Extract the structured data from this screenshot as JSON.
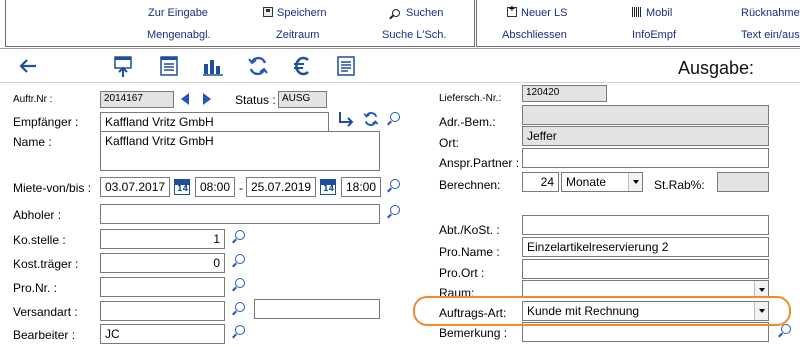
{
  "toolbar": {
    "zur_eingabe": "Zur Eingabe",
    "mengenabgl": "Mengenabgl.",
    "speichern": "Speichern",
    "zeitraum": "Zeitraum",
    "suchen": "Suchen",
    "suche_lsch": "Suche L'Sch.",
    "neuer_ls": "Neuer LS",
    "abschliessen": "Abschliessen",
    "mobil": "Mobil",
    "infoempf": "InfoEmpf",
    "ruecknahme": "Rücknahme",
    "text_ein_aus": "Text ein/aus"
  },
  "iconbar": {
    "icons": [
      "back-arrow-icon",
      "export-doc-icon",
      "list-doc-icon",
      "bar-chart-icon",
      "refresh-icon",
      "euro-icon",
      "text-doc-icon"
    ]
  },
  "heading": "Ausgabe:",
  "left": {
    "auftr_nr_label": "Auftr.Nr :",
    "auftr_nr": "2014167",
    "status_label": "Status :",
    "status": "AUSG",
    "empfaenger_label": "Empfänger :",
    "empfaenger": "Kaffland Vritz GmbH",
    "name_label": "Name :",
    "name": "Kaffland Vritz GmbH",
    "miete_label": "Miete-von/bis :",
    "von_date": "03.07.2017",
    "von_time": "08:00",
    "dash": "-",
    "bis_date": "25.07.2019",
    "bis_time": "18:00",
    "cal_num": "14",
    "abholer_label": "Abholer :",
    "abholer": "",
    "kostelle_label": "Ko.stelle :",
    "kostelle": "1",
    "kosttraeger_label": "Kost.träger :",
    "kosttraeger": "0",
    "pronr_label": "Pro.Nr. :",
    "pronr": "",
    "versandart_label": "Versandart :",
    "versandart": "",
    "versandart2": "",
    "bearbeiter_label": "Bearbeiter :",
    "bearbeiter": "JC"
  },
  "right": {
    "liefersch_label": "Liefersch.-Nr.:",
    "liefersch": "120420",
    "adr_bem_label": "Adr.-Bem.:",
    "adr_bem": "",
    "ort_label": "Ort:",
    "ort": "Jeffer",
    "anspr_label": "Anspr.Partner :",
    "anspr": "",
    "berechnen_label": "Berechnen:",
    "berechnen_num": "24",
    "berechnen_unit": "Monate",
    "strab_label": "St.Rab%:",
    "strab": "",
    "abt_label": "Abt./KoSt. :",
    "abt": "",
    "proname_label": "Pro.Name :",
    "proname": "Einzelartikelreservierung 2",
    "proort_label": "Pro.Ort :",
    "proort": "",
    "raum_label": "Raum:",
    "raum": "",
    "auftragsart_label": "Auftrags-Art:",
    "auftragsart": "Kunde mit Rechnung",
    "bemerkung_label": "Bemerkung :",
    "bemerkung": ""
  },
  "colors": {
    "toolbar_text": "#1c2d86",
    "icon_blue": "#2457b8",
    "highlight": "#f08a2a",
    "readonly_bg": "#e3e3e3"
  }
}
